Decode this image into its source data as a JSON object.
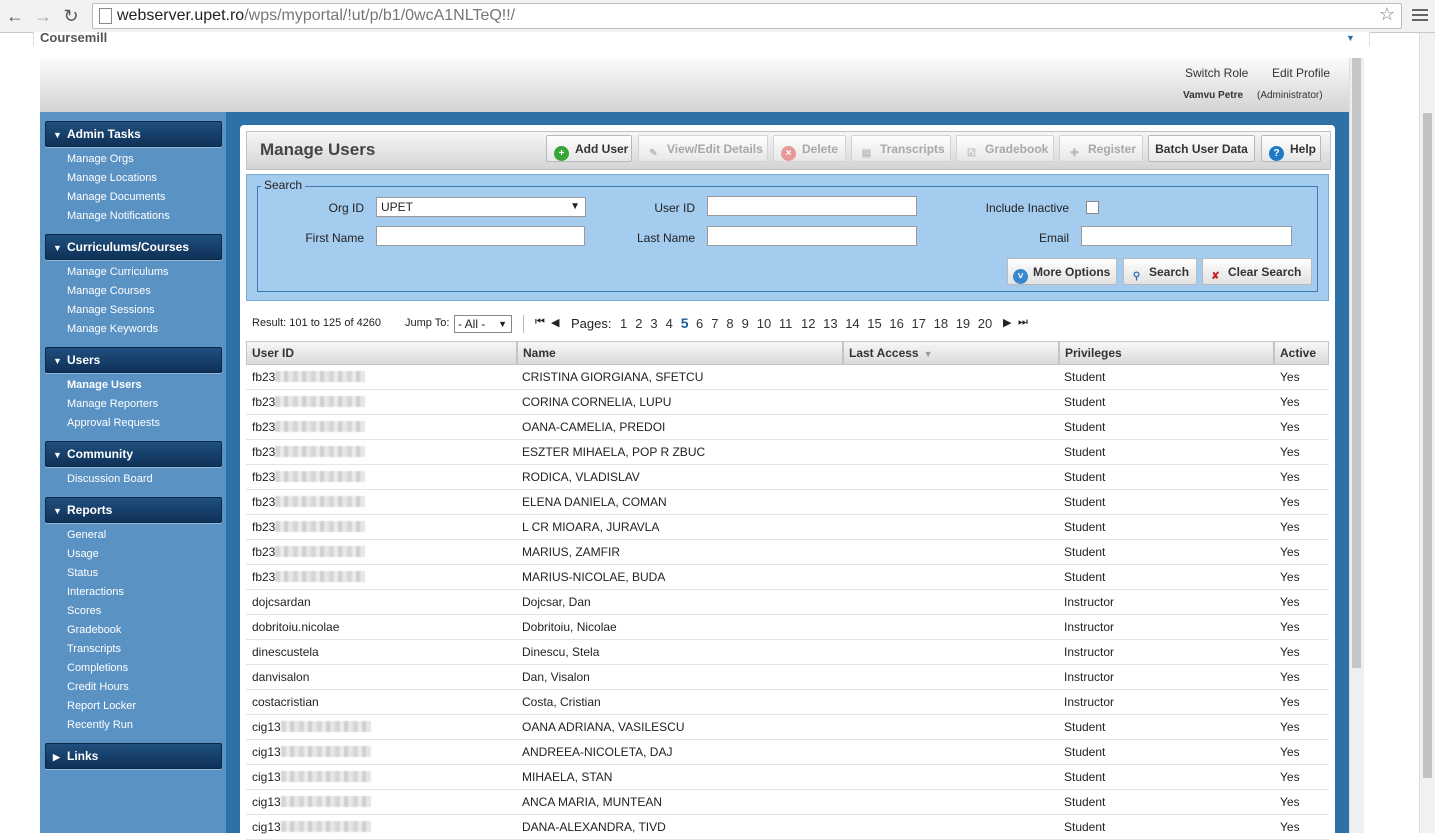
{
  "browser": {
    "url_host": "webserver.upet.ro",
    "url_path": "/wps/myportal/!ut/p/b1/0wcA1NLTeQ!!/",
    "back_icon": "arrow-left-icon",
    "forward_icon": "arrow-right-icon",
    "reload_icon": "reload-icon"
  },
  "portal": {
    "brand": "Coursemill",
    "switch_role": "Switch Role",
    "edit_profile": "Edit Profile",
    "user_name": "Vamvu Petre",
    "user_role": "(Administrator)"
  },
  "sidebar": {
    "sections": [
      {
        "title": "Admin Tasks",
        "items": [
          "Manage Orgs",
          "Manage Locations",
          "Manage Documents",
          "Manage Notifications"
        ]
      },
      {
        "title": "Curriculums/Courses",
        "items": [
          "Manage Curriculums",
          "Manage Courses",
          "Manage Sessions",
          "Manage Keywords"
        ]
      },
      {
        "title": "Users",
        "items": [
          "Manage Users",
          "Manage Reporters",
          "Approval Requests"
        ]
      },
      {
        "title": "Community",
        "items": [
          "Discussion Board"
        ]
      },
      {
        "title": "Reports",
        "items": [
          "General",
          "Usage",
          "Status",
          "Interactions",
          "Scores",
          "Gradebook",
          "Transcripts",
          "Completions",
          "Credit Hours",
          "Report Locker",
          "Recently Run"
        ]
      },
      {
        "title": "Links",
        "items": []
      }
    ],
    "active_item": "Manage Users"
  },
  "main": {
    "title": "Manage Users",
    "toolbar": {
      "add_user": "Add User",
      "view_edit": "View/Edit Details",
      "delete": "Delete",
      "transcripts": "Transcripts",
      "gradebook": "Gradebook",
      "register": "Register",
      "batch": "Batch User Data",
      "help": "Help"
    },
    "search": {
      "legend": "Search",
      "org_id_label": "Org ID",
      "org_id_value": "UPET",
      "user_id_label": "User ID",
      "include_inactive_label": "Include Inactive",
      "first_name_label": "First Name",
      "last_name_label": "Last Name",
      "email_label": "Email",
      "more_options": "More Options",
      "search": "Search",
      "clear_search": "Clear Search"
    },
    "pager": {
      "result": "Result: 101 to 125 of 4260",
      "jump_to_label": "Jump To:",
      "jump_to_value": "- All -",
      "pages_label": "Pages:",
      "pages": [
        "1",
        "2",
        "3",
        "4",
        "5",
        "6",
        "7",
        "8",
        "9",
        "10",
        "11",
        "12",
        "13",
        "14",
        "15",
        "16",
        "17",
        "18",
        "19",
        "20"
      ],
      "current_page": "5"
    },
    "table": {
      "columns": [
        "User ID",
        "Name",
        "Last Access",
        "Privileges",
        "Active"
      ],
      "rows": [
        {
          "user_id": "fb23",
          "masked": true,
          "name": "CRISTINA GIORGIANA, SFETCU",
          "last_access": "",
          "privileges": "Student",
          "active": "Yes"
        },
        {
          "user_id": "fb23",
          "masked": true,
          "name": "CORINA CORNELIA, LUPU",
          "last_access": "",
          "privileges": "Student",
          "active": "Yes"
        },
        {
          "user_id": "fb23",
          "masked": true,
          "name": "OANA-CAMELIA, PREDOI",
          "last_access": "",
          "privileges": "Student",
          "active": "Yes"
        },
        {
          "user_id": "fb23",
          "masked": true,
          "name": "ESZTER MIHAELA, POP R ZBUC",
          "last_access": "",
          "privileges": "Student",
          "active": "Yes"
        },
        {
          "user_id": "fb23",
          "masked": true,
          "name": "RODICA, VLADISLAV",
          "last_access": "",
          "privileges": "Student",
          "active": "Yes"
        },
        {
          "user_id": "fb23",
          "masked": true,
          "name": "ELENA DANIELA, COMAN",
          "last_access": "",
          "privileges": "Student",
          "active": "Yes"
        },
        {
          "user_id": "fb23",
          "masked": true,
          "name": "L CR MIOARA, JURAVLA",
          "last_access": "",
          "privileges": "Student",
          "active": "Yes"
        },
        {
          "user_id": "fb23",
          "masked": true,
          "name": "MARIUS, ZAMFIR",
          "last_access": "",
          "privileges": "Student",
          "active": "Yes"
        },
        {
          "user_id": "fb23",
          "masked": true,
          "name": "MARIUS-NICOLAE, BUDA",
          "last_access": "",
          "privileges": "Student",
          "active": "Yes"
        },
        {
          "user_id": "dojcsardan",
          "masked": false,
          "name": "Dojcsar, Dan",
          "last_access": "",
          "privileges": "Instructor",
          "active": "Yes"
        },
        {
          "user_id": "dobritoiu.nicolae",
          "masked": false,
          "name": "Dobritoiu, Nicolae",
          "last_access": "",
          "privileges": "Instructor",
          "active": "Yes"
        },
        {
          "user_id": "dinescustela",
          "masked": false,
          "name": "Dinescu, Stela",
          "last_access": "",
          "privileges": "Instructor",
          "active": "Yes"
        },
        {
          "user_id": "danvisalon",
          "masked": false,
          "name": "Dan, Visalon",
          "last_access": "",
          "privileges": "Instructor",
          "active": "Yes"
        },
        {
          "user_id": "costacristian",
          "masked": false,
          "name": "Costa, Cristian",
          "last_access": "",
          "privileges": "Instructor",
          "active": "Yes"
        },
        {
          "user_id": "cig13",
          "masked": true,
          "name": "OANA ADRIANA, VASILESCU",
          "last_access": "",
          "privileges": "Student",
          "active": "Yes"
        },
        {
          "user_id": "cig13",
          "masked": true,
          "name": "ANDREEA-NICOLETA, DAJ",
          "last_access": "",
          "privileges": "Student",
          "active": "Yes"
        },
        {
          "user_id": "cig13",
          "masked": true,
          "name": "MIHAELA, STAN",
          "last_access": "",
          "privileges": "Student",
          "active": "Yes"
        },
        {
          "user_id": "cig13",
          "masked": true,
          "name": "ANCA MARIA, MUNTEAN",
          "last_access": "",
          "privileges": "Student",
          "active": "Yes"
        },
        {
          "user_id": "cig13",
          "masked": true,
          "name": "DANA-ALEXANDRA, TIVD",
          "last_access": "",
          "privileges": "Student",
          "active": "Yes"
        }
      ]
    }
  },
  "colors": {
    "sidebar_bg": "#5a92c4",
    "frame_blue": "#2e71a7",
    "search_bg": "#a4ccef",
    "current_page": "#1e5fa0"
  }
}
